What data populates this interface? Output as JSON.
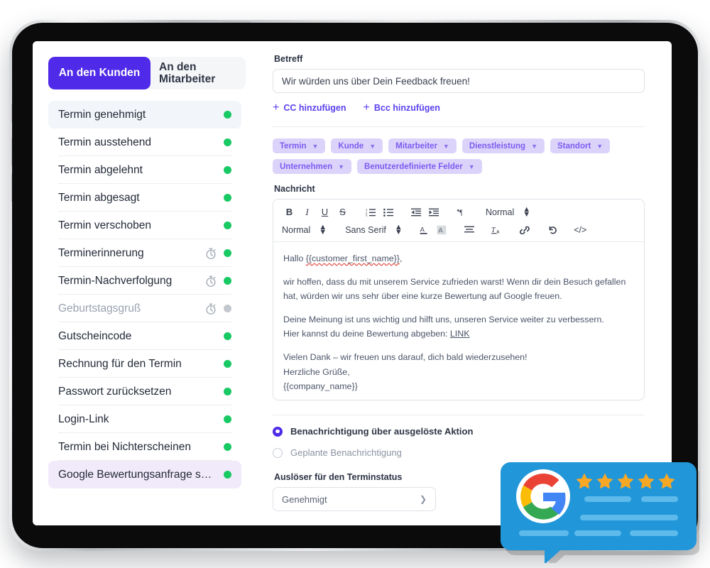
{
  "segmented": {
    "tab_customer": "An den Kunden",
    "tab_staff": "An den Mitarbeiter",
    "active": "An den Kunden"
  },
  "sidebar": {
    "items": [
      {
        "label": "Termin genehmigt",
        "timer": false,
        "status": "on",
        "state": "hover"
      },
      {
        "label": "Termin ausstehend",
        "timer": false,
        "status": "on",
        "state": "normal"
      },
      {
        "label": "Termin abgelehnt",
        "timer": false,
        "status": "on",
        "state": "normal"
      },
      {
        "label": "Termin abgesagt",
        "timer": false,
        "status": "on",
        "state": "normal"
      },
      {
        "label": "Termin verschoben",
        "timer": false,
        "status": "on",
        "state": "normal"
      },
      {
        "label": "Terminerinnerung",
        "timer": true,
        "status": "on",
        "state": "normal"
      },
      {
        "label": "Termin-Nachverfolgung",
        "timer": true,
        "status": "on",
        "state": "normal"
      },
      {
        "label": "Geburtstagsgruß",
        "timer": true,
        "status": "off",
        "state": "disabled"
      },
      {
        "label": "Gutscheincode",
        "timer": false,
        "status": "on",
        "state": "normal"
      },
      {
        "label": "Rechnung für den Termin",
        "timer": false,
        "status": "on",
        "state": "normal"
      },
      {
        "label": "Passwort zurücksetzen",
        "timer": false,
        "status": "on",
        "state": "normal"
      },
      {
        "label": "Login-Link",
        "timer": false,
        "status": "on",
        "state": "normal"
      },
      {
        "label": "Termin bei Nichterscheinen",
        "timer": false,
        "status": "on",
        "state": "normal"
      },
      {
        "label": "Google Bewertungsanfrage s…",
        "timer": false,
        "status": "on",
        "state": "selected"
      }
    ]
  },
  "subject": {
    "label": "Betreff",
    "value": "Wir würden uns über Dein Feedback freuen!",
    "placeholder": "Wir würden uns über Dein Feedback freuen!"
  },
  "recipients": {
    "cc_label": "CC hinzufügen",
    "bcc_label": "Bcc hinzufügen"
  },
  "variables": {
    "chips": [
      "Termin",
      "Kunde",
      "Mitarbeiter",
      "Dienstleistung",
      "Standort",
      "Unternehmen",
      "Benutzerdefinierte Felder"
    ]
  },
  "message": {
    "label": "Nachricht",
    "toolbar": {
      "bold": "B",
      "italic": "I",
      "underline": "U",
      "strike": "S",
      "ordered_list": "ordered-list-icon",
      "bullet_list": "bullet-list-icon",
      "outdent": "outdent-icon",
      "indent": "indent-icon",
      "direction": "text-direction-icon",
      "heading_select": "Normal",
      "size_select": "Normal",
      "font_select": "Sans Serif",
      "text_color": "A",
      "highlight_color": "A",
      "align": "align-icon",
      "clear_format": "Tx",
      "link": "link-icon",
      "undo": "undo-icon",
      "code": "</>"
    },
    "body": {
      "greeting_prefix": "Hallo ",
      "greeting_var": "{{customer_first_name}}",
      "greeting_suffix": ",",
      "para1": "wir hoffen, dass du mit unserem Service zufrieden warst! Wenn dir dein Besuch gefallen hat, würden wir uns sehr über eine kurze Bewertung auf Google freuen.",
      "para2": "Deine Meinung ist uns wichtig und hilft uns, unseren Service weiter zu verbessern.",
      "para3_prefix": "Hier kannst du deine Bewertung abgeben: ",
      "para3_link": "LINK",
      "para4": "Vielen Dank – wir freuen uns darauf, dich bald wiederzusehen!",
      "para5": "Herzliche Grüße,",
      "para6": "{{company_name}}"
    }
  },
  "notification": {
    "option_triggered": "Benachrichtigung über ausgelöste Aktion",
    "option_scheduled": "Geplante Benachrichtigung",
    "selected": "Benachrichtigung über ausgelöste Aktion"
  },
  "trigger": {
    "label": "Auslöser für den Terminstatus",
    "value": "Genehmigt"
  },
  "google_badge": {
    "logo": "google-g-icon",
    "stars": 5,
    "star_color": "#f9a825",
    "bubble_color": "#2196d9"
  },
  "colors": {
    "accent": "#4f2ae9",
    "chip_bg": "#dcd3fb",
    "chip_text": "#7b5cf0",
    "status_on": "#18c964",
    "status_off": "#c3c7ce",
    "selected_row": "#f1eafb",
    "hover_row": "#f2f5f9"
  }
}
